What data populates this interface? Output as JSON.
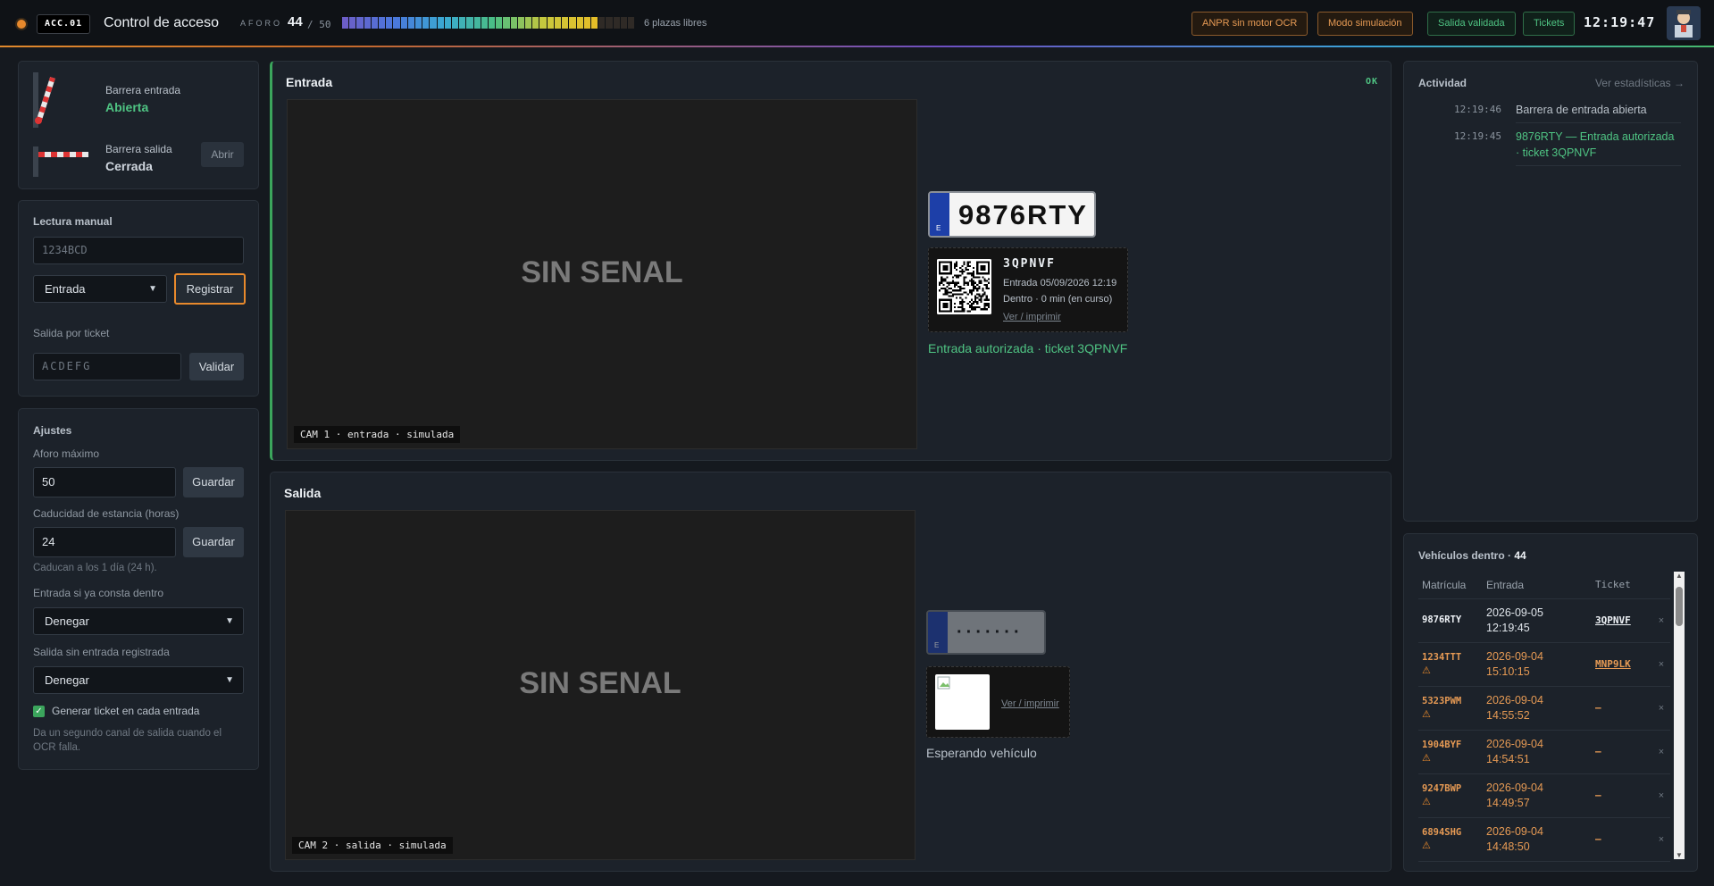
{
  "header": {
    "code": "ACC.01",
    "title": "Control de acceso",
    "aforo_label": "AFORO",
    "aforo_value": "44",
    "aforo_max": "/ 50",
    "libres": "6 plazas libres",
    "buttons": {
      "anpr": "ANPR sin motor OCR",
      "sim": "Modo simulación",
      "salida": "Salida validada",
      "tickets": "Tickets"
    },
    "clock": "12:19:47",
    "occupancy": 0.88
  },
  "barriers": {
    "entrada_label": "Barrera entrada",
    "entrada_state": "Abierta",
    "salida_label": "Barrera salida",
    "salida_state": "Cerrada",
    "abrir": "Abrir"
  },
  "manual": {
    "title": "Lectura manual",
    "plate_placeholder": "1234BCD",
    "direction": "Entrada",
    "register": "Registrar",
    "ticket_label": "Salida por ticket",
    "ticket_placeholder": "ACDEFG",
    "validate": "Validar"
  },
  "settings": {
    "title": "Ajustes",
    "max_label": "Aforo máximo",
    "max_value": "50",
    "save": "Guardar",
    "expiry_label": "Caducidad de estancia (horas)",
    "expiry_value": "24",
    "expiry_hint": "Caducan a los 1 día (24 h).",
    "dup_label": "Entrada si ya consta dentro",
    "dup_value": "Denegar",
    "noentry_label": "Salida sin entrada registrada",
    "noentry_value": "Denegar",
    "ticket_check_label": "Generar ticket en cada entrada",
    "ticket_hint": "Da un segundo canal de salida cuando el OCR falla."
  },
  "entrada": {
    "title": "Entrada",
    "status": "OK",
    "no_signal": "SIN SENAL",
    "cam": "CAM 1 · entrada · simulada",
    "plate": "9876RTY",
    "plate_country": "E",
    "ticket_code": "3QPNVF",
    "ticket_line1": "Entrada 05/09/2026 12:19",
    "ticket_line2": "Dentro · 0 min (en curso)",
    "ticket_link": "Ver / imprimir",
    "message": "Entrada autorizada · ticket 3QPNVF"
  },
  "salida": {
    "title": "Salida",
    "no_signal": "SIN SENAL",
    "cam": "CAM 2 · salida · simulada",
    "plate": "·······",
    "plate_country": "E",
    "ticket_link": "Ver / imprimir",
    "message": "Esperando vehículo"
  },
  "activity": {
    "title": "Actividad",
    "link": "Ver estadísticas →",
    "items": [
      {
        "time": "12:19:46",
        "msg": "Barrera de entrada abierta",
        "color": "#b8c0c8"
      },
      {
        "time": "12:19:45",
        "msg": "9876RTY — Entrada autorizada · ticket 3QPNVF",
        "color": "#4fc483"
      }
    ]
  },
  "vehicles": {
    "title": "Vehículos dentro ·",
    "count": "44",
    "columns": [
      "Matrícula",
      "Entrada",
      "Ticket"
    ],
    "rows": [
      {
        "plate": "9876RTY",
        "warn": false,
        "date": "2026-09-05",
        "time": "12:19:45",
        "ticket": "3QPNVF"
      },
      {
        "plate": "1234TTT",
        "warn": true,
        "date": "2026-09-04",
        "time": "15:10:15",
        "ticket": "MNP9LK"
      },
      {
        "plate": "5323PWM",
        "warn": true,
        "date": "2026-09-04",
        "time": "14:55:52",
        "ticket": "—"
      },
      {
        "plate": "1904BYF",
        "warn": true,
        "date": "2026-09-04",
        "time": "14:54:51",
        "ticket": "—"
      },
      {
        "plate": "9247BWP",
        "warn": true,
        "date": "2026-09-04",
        "time": "14:49:57",
        "ticket": "—"
      },
      {
        "plate": "6894SHG",
        "warn": true,
        "date": "2026-09-04",
        "time": "14:48:50",
        "ticket": "—"
      }
    ]
  },
  "colors": {
    "accent_green": "#4fc483",
    "accent_orange": "#e69a54",
    "warn": "#e8892c"
  }
}
